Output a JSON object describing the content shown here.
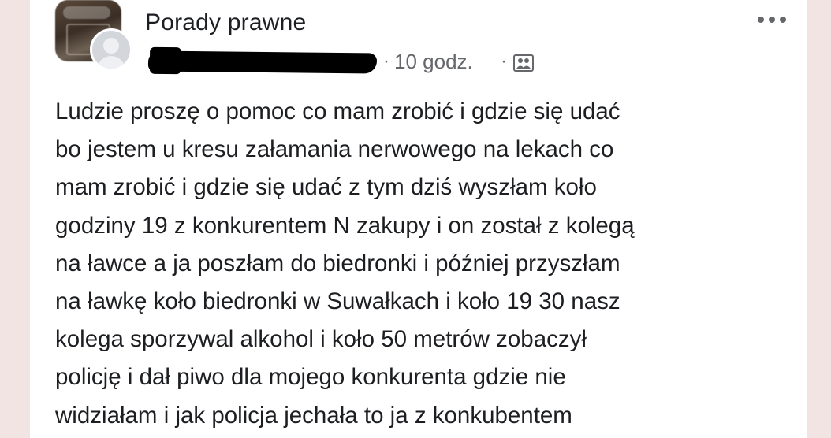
{
  "post": {
    "group_name": "Porady prawne",
    "meta": {
      "separator": "·",
      "time": "10 godz.",
      "audience_icon": "group-audience-icon"
    },
    "more_icon": "more-options-icon",
    "lines": [
      "Ludzie proszę o pomoc co mam zrobić i gdzie się udać",
      "bo jestem u kresu załamania nerwowego na lekach co",
      "mam zrobić i gdzie się udać z tym dziś wyszłam koło",
      "godziny 19 z konkurentem N zakupy i on został z kolegą",
      "na ławce a ja poszłam do biedronki i później przyszłam",
      "na ławkę koło biedronki w Suwałkach i koło 19  30 nasz",
      "kolega sporzywal alkohol i koło 50 metrów zobaczył",
      "policję i dał piwo dla mojego konkurenta gdzie nie",
      "widziałam i jak policja jechała to ja z konkubentem"
    ]
  },
  "colors": {
    "background": "#f3e4e4",
    "card": "#ffffff",
    "text": "#1c1e21",
    "meta_text": "#65676b",
    "redaction": "#000000"
  }
}
